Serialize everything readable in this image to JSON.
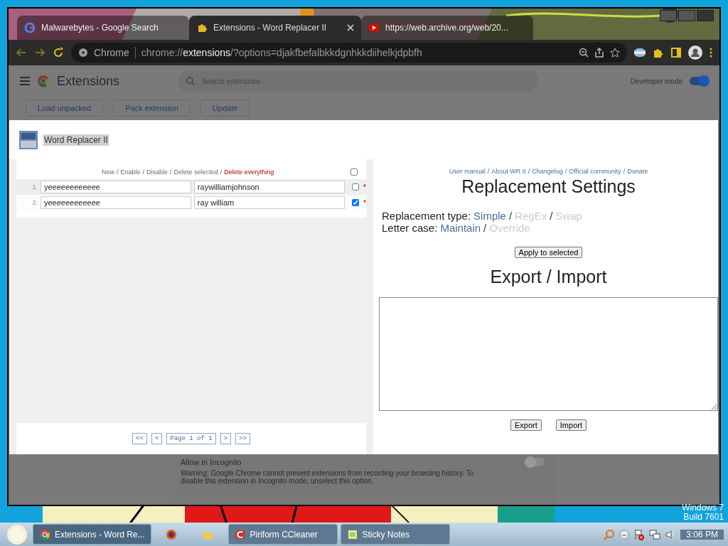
{
  "browser": {
    "tabs": [
      {
        "title": "Malwarebytes - Google Search",
        "kind": "google",
        "selected": false
      },
      {
        "title": "Extensions - Word Replacer II",
        "kind": "puzzle",
        "selected": true
      },
      {
        "title": "https://web.archive.org/web/20...",
        "kind": "youtube",
        "selected": false
      }
    ],
    "address_bar": {
      "label": "Chrome",
      "url": "chrome://**extensions**/?options=djakfbefalbkkdgnhkkdiihelkjdpbfh"
    }
  },
  "extensions_page": {
    "title": "Extensions",
    "search": {
      "placeholder": "Search extensions"
    },
    "developer_mode": {
      "label": "Developer mode",
      "on": true
    },
    "buttons": [
      "Load unpacked",
      "Pack extension",
      "Update"
    ],
    "incognito": {
      "title": "Allow in Incognito",
      "warning": "Warning: Google Chrome cannot prevent extensions from recording your browsing history. To disable this extension in Incognito mode, unselect this option.",
      "on": false
    }
  },
  "dialog": {
    "title": "Word Replacer II",
    "separator": "/",
    "toolbar_links": [
      {
        "label": "New",
        "kind": "normal"
      },
      {
        "label": "Enable",
        "kind": "normal"
      },
      {
        "label": "Disable",
        "kind": "normal"
      },
      {
        "label": "Delete selected",
        "kind": "normal"
      },
      {
        "label": "Delete everything",
        "kind": "danger"
      }
    ],
    "select_all": false,
    "rules": [
      {
        "number": "1.",
        "find": "yeeeeeeeeeeee",
        "replace": "raywilliamjohnson",
        "selected": false,
        "hovered": true,
        "mark": "*"
      },
      {
        "number": "2.",
        "find": "yeeeeeeeeeeee",
        "replace": "ray william",
        "selected": true,
        "hovered": false,
        "mark": "*"
      }
    ],
    "pager": {
      "first": "<<",
      "prev": "<",
      "page": "Page 1 of 1",
      "next": ">",
      "last": ">>"
    },
    "help_links": [
      "User manual",
      "About WR II",
      "Changelog",
      "Official community",
      "Donate"
    ],
    "settings_title": "Replacement Settings",
    "settings": [
      {
        "label": "Replacement type:",
        "options": [
          {
            "label": "Simple",
            "selected": true
          },
          {
            "label": "RegEx",
            "selected": false
          },
          {
            "label": "Swap",
            "selected": false
          }
        ]
      },
      {
        "label": "Letter case:",
        "options": [
          {
            "label": "Maintain",
            "selected": true
          },
          {
            "label": "Override",
            "selected": false
          }
        ]
      }
    ],
    "apply_button": "Apply to selected",
    "export_title": "Export / Import",
    "export_buttons": [
      "Export",
      "Import"
    ]
  },
  "desktop": {
    "watermark": [
      "Windows 7",
      "Build 7601"
    ]
  },
  "taskbar": {
    "tasks": [
      {
        "label": "Extensions - Word Re...",
        "kind": "chrome",
        "selected": true
      },
      {
        "kind": "firefox",
        "selected": false
      },
      {
        "kind": "folder",
        "selected": false
      },
      {
        "label": "Piriform CCleaner",
        "kind": "ccleaner",
        "selected": false
      },
      {
        "label": "Sticky Notes",
        "kind": "sticky",
        "selected": false
      }
    ],
    "clock": "3:06 PM"
  }
}
